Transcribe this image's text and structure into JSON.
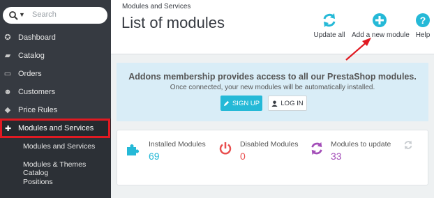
{
  "sidebar": {
    "search_placeholder": "Search",
    "items": [
      {
        "label": "Dashboard",
        "icon": "dashboard-icon"
      },
      {
        "label": "Catalog",
        "icon": "catalog-icon"
      },
      {
        "label": "Orders",
        "icon": "orders-icon"
      },
      {
        "label": "Customers",
        "icon": "customers-icon"
      },
      {
        "label": "Price Rules",
        "icon": "price-rules-icon"
      }
    ],
    "active_item": {
      "label": "Modules and Services",
      "icon": "puzzle-icon"
    },
    "submenu": [
      "Modules and Services",
      "Modules & Themes Catalog",
      "Positions"
    ]
  },
  "header": {
    "breadcrumb": "Modules and Services",
    "title": "List of modules",
    "toolbar": {
      "update_all": "Update all",
      "add_new_module": "Add a new module",
      "help": "Help"
    }
  },
  "banner": {
    "title": "Addons membership provides access to all our PrestaShop modules.",
    "subtitle": "Once connected, your new modules will be automatically installed.",
    "signup_label": "SIGN UP",
    "login_label": "LOG IN"
  },
  "stats": [
    {
      "title": "Installed Modules",
      "value": "69",
      "color": "#25b9d7",
      "icon": "puzzle-icon"
    },
    {
      "title": "Disabled Modules",
      "value": "0",
      "color": "#e84e4e",
      "icon": "power-icon"
    },
    {
      "title": "Modules to update",
      "value": "33",
      "color": "#a34db8",
      "icon": "refresh-icon"
    }
  ],
  "colors": {
    "sidebar_bg": "#363a41",
    "accent": "#25b9d7",
    "highlight": "#e01a22",
    "banner_bg": "#d9edf7"
  }
}
